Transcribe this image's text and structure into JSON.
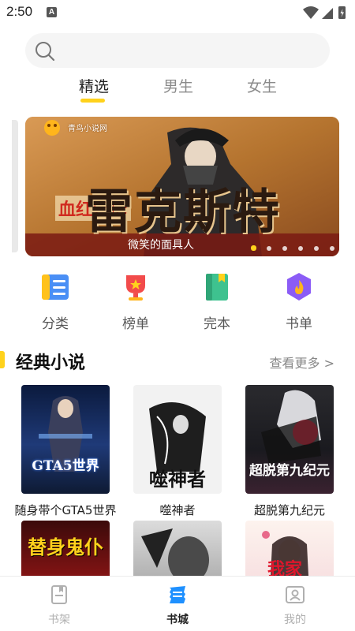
{
  "status_bar": {
    "time": "2:50",
    "notification_badge": "A"
  },
  "search": {
    "placeholder": ""
  },
  "tabs": [
    {
      "label": "精选",
      "active": true
    },
    {
      "label": "男生",
      "active": false
    },
    {
      "label": "女生",
      "active": false
    }
  ],
  "banner": {
    "logo_text": "青鸟小说网",
    "title": "雷克斯特",
    "subtitle": "血红色的",
    "author": "微笑的面具人",
    "pages": 6,
    "active_page": 1
  },
  "categories": [
    {
      "label": "分类",
      "icon": "list-icon"
    },
    {
      "label": "榜单",
      "icon": "trophy-icon"
    },
    {
      "label": "完本",
      "icon": "book-icon"
    },
    {
      "label": "书单",
      "icon": "fire-icon"
    }
  ],
  "section": {
    "title": "经典小说",
    "more_label": "查看更多 >"
  },
  "books": [
    {
      "title": "随身带个GTA5世界",
      "cover_text": "GTA5世界"
    },
    {
      "title": "噬神者",
      "cover_text": "噬神者"
    },
    {
      "title": "超脱第九纪元",
      "cover_text": "超脱第九纪元"
    },
    {
      "title": "",
      "cover_text": "替身鬼仆"
    },
    {
      "title": "",
      "cover_text": ""
    },
    {
      "title": "",
      "cover_text": "我家"
    }
  ],
  "bottom_nav": [
    {
      "label": "书架",
      "icon": "bookshelf-icon",
      "active": false
    },
    {
      "label": "书城",
      "icon": "bookstore-icon",
      "active": true
    },
    {
      "label": "我的",
      "icon": "profile-icon",
      "active": false
    }
  ],
  "colors": {
    "accent": "#ffd21c",
    "active_nav": "#1e90ff",
    "inactive_nav": "#b0b0b0"
  }
}
